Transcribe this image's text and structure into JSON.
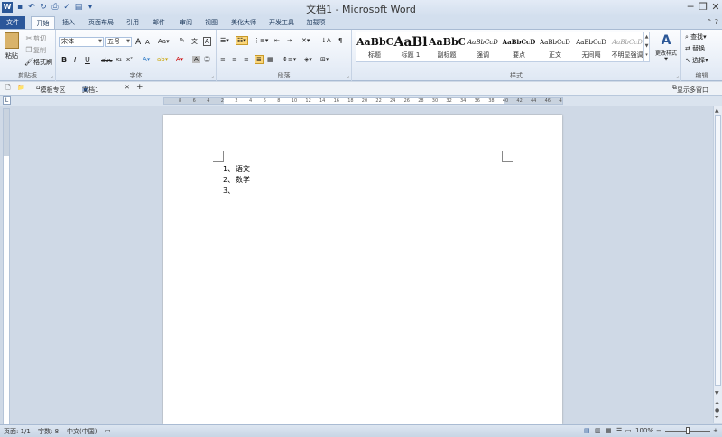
{
  "title_bar": {
    "app_icon": "W",
    "title": "文档1 - Microsoft Word",
    "quick_access": [
      "save-icon",
      "undo-icon",
      "redo-icon",
      "print-preview-icon",
      "spell-check-icon",
      "format-icon",
      "customize-icon"
    ]
  },
  "tabs": [
    "文件",
    "开始",
    "插入",
    "页面布局",
    "引用",
    "邮件",
    "审阅",
    "视图",
    "美化大师",
    "开发工具",
    "加载项"
  ],
  "ribbon": {
    "clipboard": {
      "label": "剪贴板",
      "paste": "粘贴",
      "cut": "剪切",
      "copy": "复制",
      "format_painter": "格式刷"
    },
    "font": {
      "label": "字体",
      "font_name": "宋体",
      "font_size": "五号",
      "grow": "A",
      "shrink": "A",
      "bold": "B",
      "italic": "I",
      "underline": "U",
      "strike": "abc",
      "subscript": "x₂",
      "superscript": "x²"
    },
    "paragraph": {
      "label": "段落"
    },
    "styles": {
      "label": "样式",
      "items": [
        {
          "sample": "AaBbC",
          "name": "标题"
        },
        {
          "sample": "AaBl",
          "name": "标题 1"
        },
        {
          "sample": "AaBbC",
          "name": "副标题"
        },
        {
          "sample": "AaBbCcD",
          "name": "强调"
        },
        {
          "sample": "AaBbCcD",
          "name": "要点"
        },
        {
          "sample": "AaBbCcD",
          "name": "正文"
        },
        {
          "sample": "AaBbCcD",
          "name": "无间隔"
        },
        {
          "sample": "AaBbCcD",
          "name": "不明显强调"
        }
      ],
      "change_styles": "更改样式"
    },
    "editing": {
      "label": "编辑",
      "find": "查找",
      "replace": "替换",
      "select": "选择"
    }
  },
  "doc_tabs": {
    "home": "模板专区",
    "doc": "文档1",
    "add": "+",
    "multi_window": "显示多窗口"
  },
  "ruler_ticks": [
    "8",
    "6",
    "4",
    "2",
    "2",
    "4",
    "6",
    "8",
    "10",
    "12",
    "14",
    "16",
    "18",
    "20",
    "22",
    "24",
    "26",
    "28",
    "30",
    "32",
    "34",
    "36",
    "38",
    "40",
    "42",
    "44",
    "46",
    "48"
  ],
  "document": {
    "list": [
      {
        "num": "1、",
        "text": "语文"
      },
      {
        "num": "2、",
        "text": "数学"
      },
      {
        "num": "3、",
        "text": ""
      }
    ]
  },
  "status_bar": {
    "page": "页面: 1/1",
    "words": "字数: 8",
    "language": "中文(中国)",
    "zoom": "100%",
    "zoom_out": "−",
    "zoom_in": "+"
  }
}
